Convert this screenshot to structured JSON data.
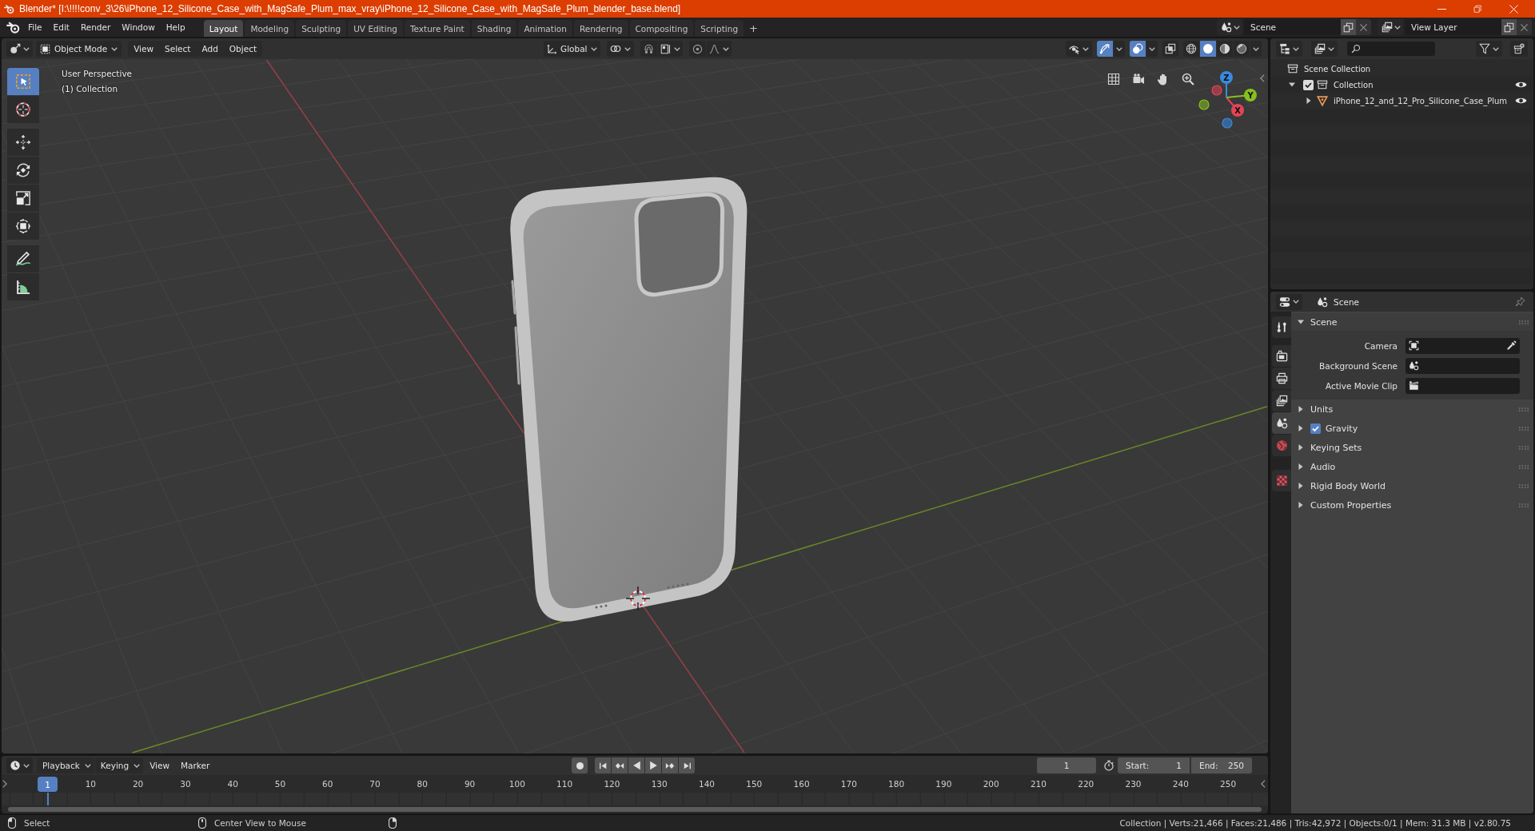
{
  "window": {
    "title": "Blender* [I:\\!!!!conv_3\\26\\iPhone_12_Silicone_Case_with_MagSafe_Plum_max_vray\\iPhone_12_Silicone_Case_with_MagSafe_Plum_blender_base.blend]"
  },
  "top_bar": {
    "menus": [
      "File",
      "Edit",
      "Render",
      "Window",
      "Help"
    ],
    "workspaces": [
      {
        "label": "Layout",
        "selected": true
      },
      {
        "label": "Modeling",
        "selected": false
      },
      {
        "label": "Sculpting",
        "selected": false
      },
      {
        "label": "UV Editing",
        "selected": false
      },
      {
        "label": "Texture Paint",
        "selected": false
      },
      {
        "label": "Shading",
        "selected": false
      },
      {
        "label": "Animation",
        "selected": false
      },
      {
        "label": "Rendering",
        "selected": false
      },
      {
        "label": "Compositing",
        "selected": false
      },
      {
        "label": "Scripting",
        "selected": false
      }
    ],
    "add_workspace": "+",
    "scene": "Scene",
    "view_layer": "View Layer"
  },
  "viewport": {
    "header": {
      "mode": "Object Mode",
      "menus": [
        "View",
        "Select",
        "Add",
        "Object"
      ],
      "orientation": "Global",
      "toggles": [
        {
          "kind": "gizmos",
          "on": true
        },
        {
          "kind": "overlays",
          "on": true
        },
        {
          "kind": "xray",
          "on": false
        }
      ],
      "shading": [
        {
          "kind": "wireframe",
          "selected": false
        },
        {
          "kind": "solid",
          "selected": true
        },
        {
          "kind": "material",
          "selected": false
        },
        {
          "kind": "rendered",
          "selected": false
        }
      ]
    },
    "tools": [
      {
        "kind": "select_box",
        "selected": true
      },
      {
        "kind": "cursor",
        "selected": false
      },
      {
        "kind": "move",
        "selected": false
      },
      {
        "kind": "rotate",
        "selected": false
      },
      {
        "kind": "scale",
        "selected": false
      },
      {
        "kind": "transform",
        "selected": false
      },
      {
        "kind": "annotate",
        "selected": false
      },
      {
        "kind": "measure",
        "selected": false
      }
    ],
    "view_name": "User Perspective",
    "collection_name": "(1) Collection",
    "gizmo_axes": [
      {
        "label": "X",
        "color": "#e34457"
      },
      {
        "label": "Y",
        "color": "#86c01e"
      },
      {
        "label": "Z",
        "color": "#3a8ae0"
      }
    ]
  },
  "outliner": {
    "items": [
      {
        "label": "Scene Collection",
        "kind": "scene_collection",
        "children": [
          {
            "label": "Collection",
            "kind": "collection",
            "expanded": true,
            "checked": true,
            "visible": true,
            "children": [
              {
                "label": "iPhone_12_and_12_Pro_Silicone_Case_Plum",
                "kind": "mesh",
                "expanded": false,
                "visible": true
              }
            ]
          }
        ]
      }
    ]
  },
  "properties": {
    "header": "Scene",
    "tabs": [
      {
        "kind": "tool",
        "selected": false
      },
      {
        "kind": "render",
        "selected": false
      },
      {
        "kind": "output",
        "selected": false
      },
      {
        "kind": "view_layer",
        "selected": false
      },
      {
        "kind": "scene",
        "selected": true
      },
      {
        "kind": "world",
        "selected": false
      },
      {
        "kind": "texture",
        "selected": false
      }
    ],
    "panel": {
      "title": "Scene",
      "expanded": true,
      "fields": [
        {
          "label": "Camera",
          "kind": "object"
        },
        {
          "label": "Background Scene",
          "kind": "scene"
        },
        {
          "label": "Active Movie Clip",
          "kind": "clip"
        }
      ]
    },
    "sections": [
      {
        "label": "Units",
        "kind": "plain",
        "expanded": false
      },
      {
        "label": "Gravity",
        "kind": "checkbox",
        "checked": true,
        "expanded": false
      },
      {
        "label": "Keying Sets",
        "kind": "plain",
        "expanded": false
      },
      {
        "label": "Audio",
        "kind": "plain",
        "expanded": false
      },
      {
        "label": "Rigid Body World",
        "kind": "plain",
        "expanded": false
      },
      {
        "label": "Custom Properties",
        "kind": "plain",
        "expanded": false
      }
    ]
  },
  "timeline": {
    "menus": [
      {
        "label": "Playback",
        "kind": "dropdown"
      },
      {
        "label": "Keying",
        "kind": "dropdown"
      },
      {
        "label": "View",
        "kind": "menu"
      },
      {
        "label": "Marker",
        "kind": "menu"
      }
    ],
    "frame_field": "1",
    "start": {
      "label": "Start:",
      "value": "1"
    },
    "end": {
      "label": "End:",
      "value": "250"
    },
    "current_frame": "1",
    "ruler": [
      "10",
      "20",
      "30",
      "40",
      "50",
      "60",
      "70",
      "80",
      "90",
      "100",
      "110",
      "120",
      "130",
      "140",
      "150",
      "160",
      "170",
      "180",
      "190",
      "200",
      "210",
      "220",
      "230",
      "240",
      "250"
    ]
  },
  "status_bar": {
    "hints": [
      {
        "kind": "left_mouse",
        "label": "Select"
      },
      {
        "kind": "middle_mouse",
        "label": "Center View to Mouse"
      },
      {
        "kind": "right_mouse"
      }
    ],
    "stats": "Collection | Verts:21,466 | Faces:21,486 | Tris:42,972 | Objects:0/1 | Mem: 31.3 MB | v2.80.75"
  }
}
